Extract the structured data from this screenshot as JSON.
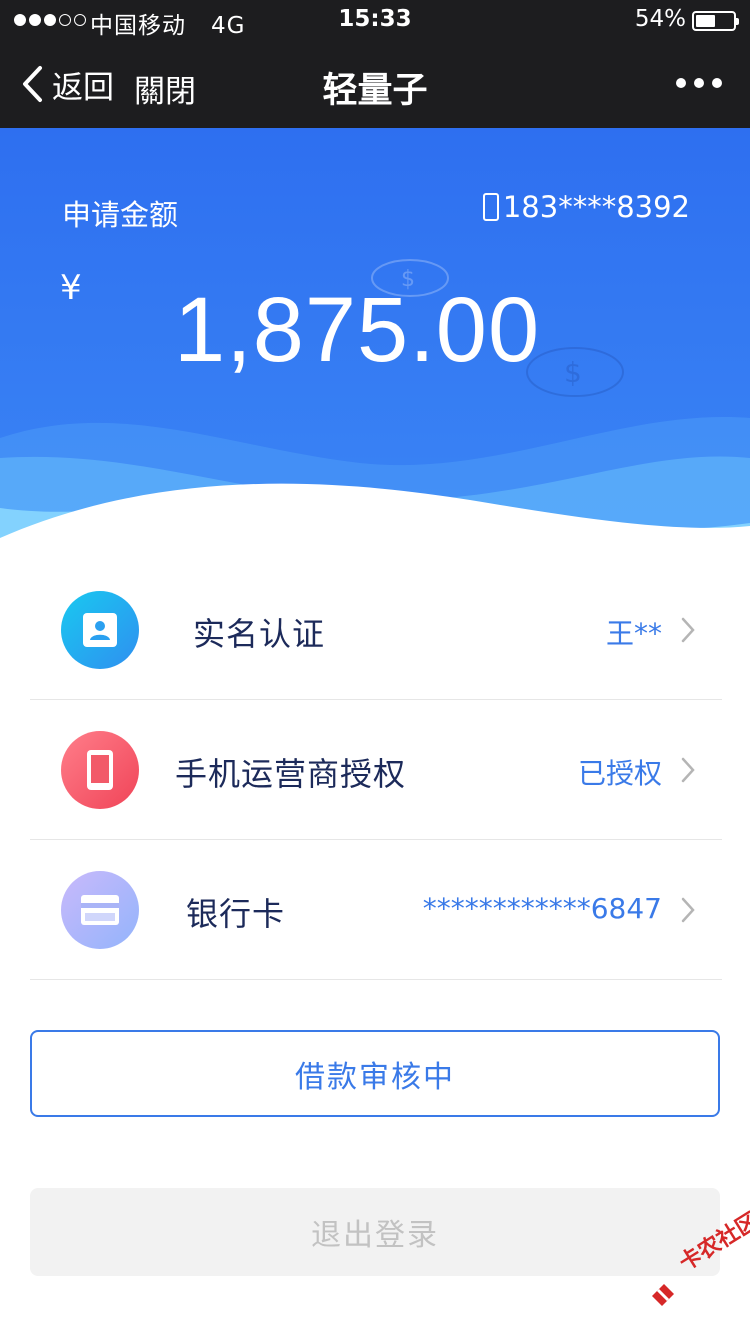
{
  "status_bar": {
    "signal_dots": 5,
    "signal_filled": 3,
    "carrier": "中国移动",
    "network": "4G",
    "time": "15:33",
    "battery_pct": "54%",
    "battery_level": 0.54
  },
  "nav": {
    "back_label": "返回",
    "close_label": "關閉",
    "title": "轻量子"
  },
  "hero": {
    "amount_label": "申请金额",
    "phone": "183****8392",
    "currency": "¥",
    "amount": "1,875.00",
    "colors": {
      "top": "#2e6ff0",
      "bottom": "#3b86f5",
      "wave_light": "#8fdcff"
    }
  },
  "list": [
    {
      "label": "实名认证",
      "value": "王**",
      "icon": "id-card-icon",
      "icon_colors": [
        "#19c9f0",
        "#2f8ff0"
      ]
    },
    {
      "label": "手机运营商授权",
      "value": "已授权",
      "icon": "mobile-phone-icon",
      "icon_colors": [
        "#ff7e8a",
        "#f04458"
      ]
    },
    {
      "label": "银行卡",
      "value": "************6847",
      "icon": "bank-card-icon",
      "icon_colors": [
        "#c9b9fb",
        "#93b4fb"
      ]
    }
  ],
  "buttons": {
    "review": "借款审核中",
    "logout": "退出登录"
  },
  "watermark": {
    "text": "卡农社区",
    "color": "#d62828"
  }
}
